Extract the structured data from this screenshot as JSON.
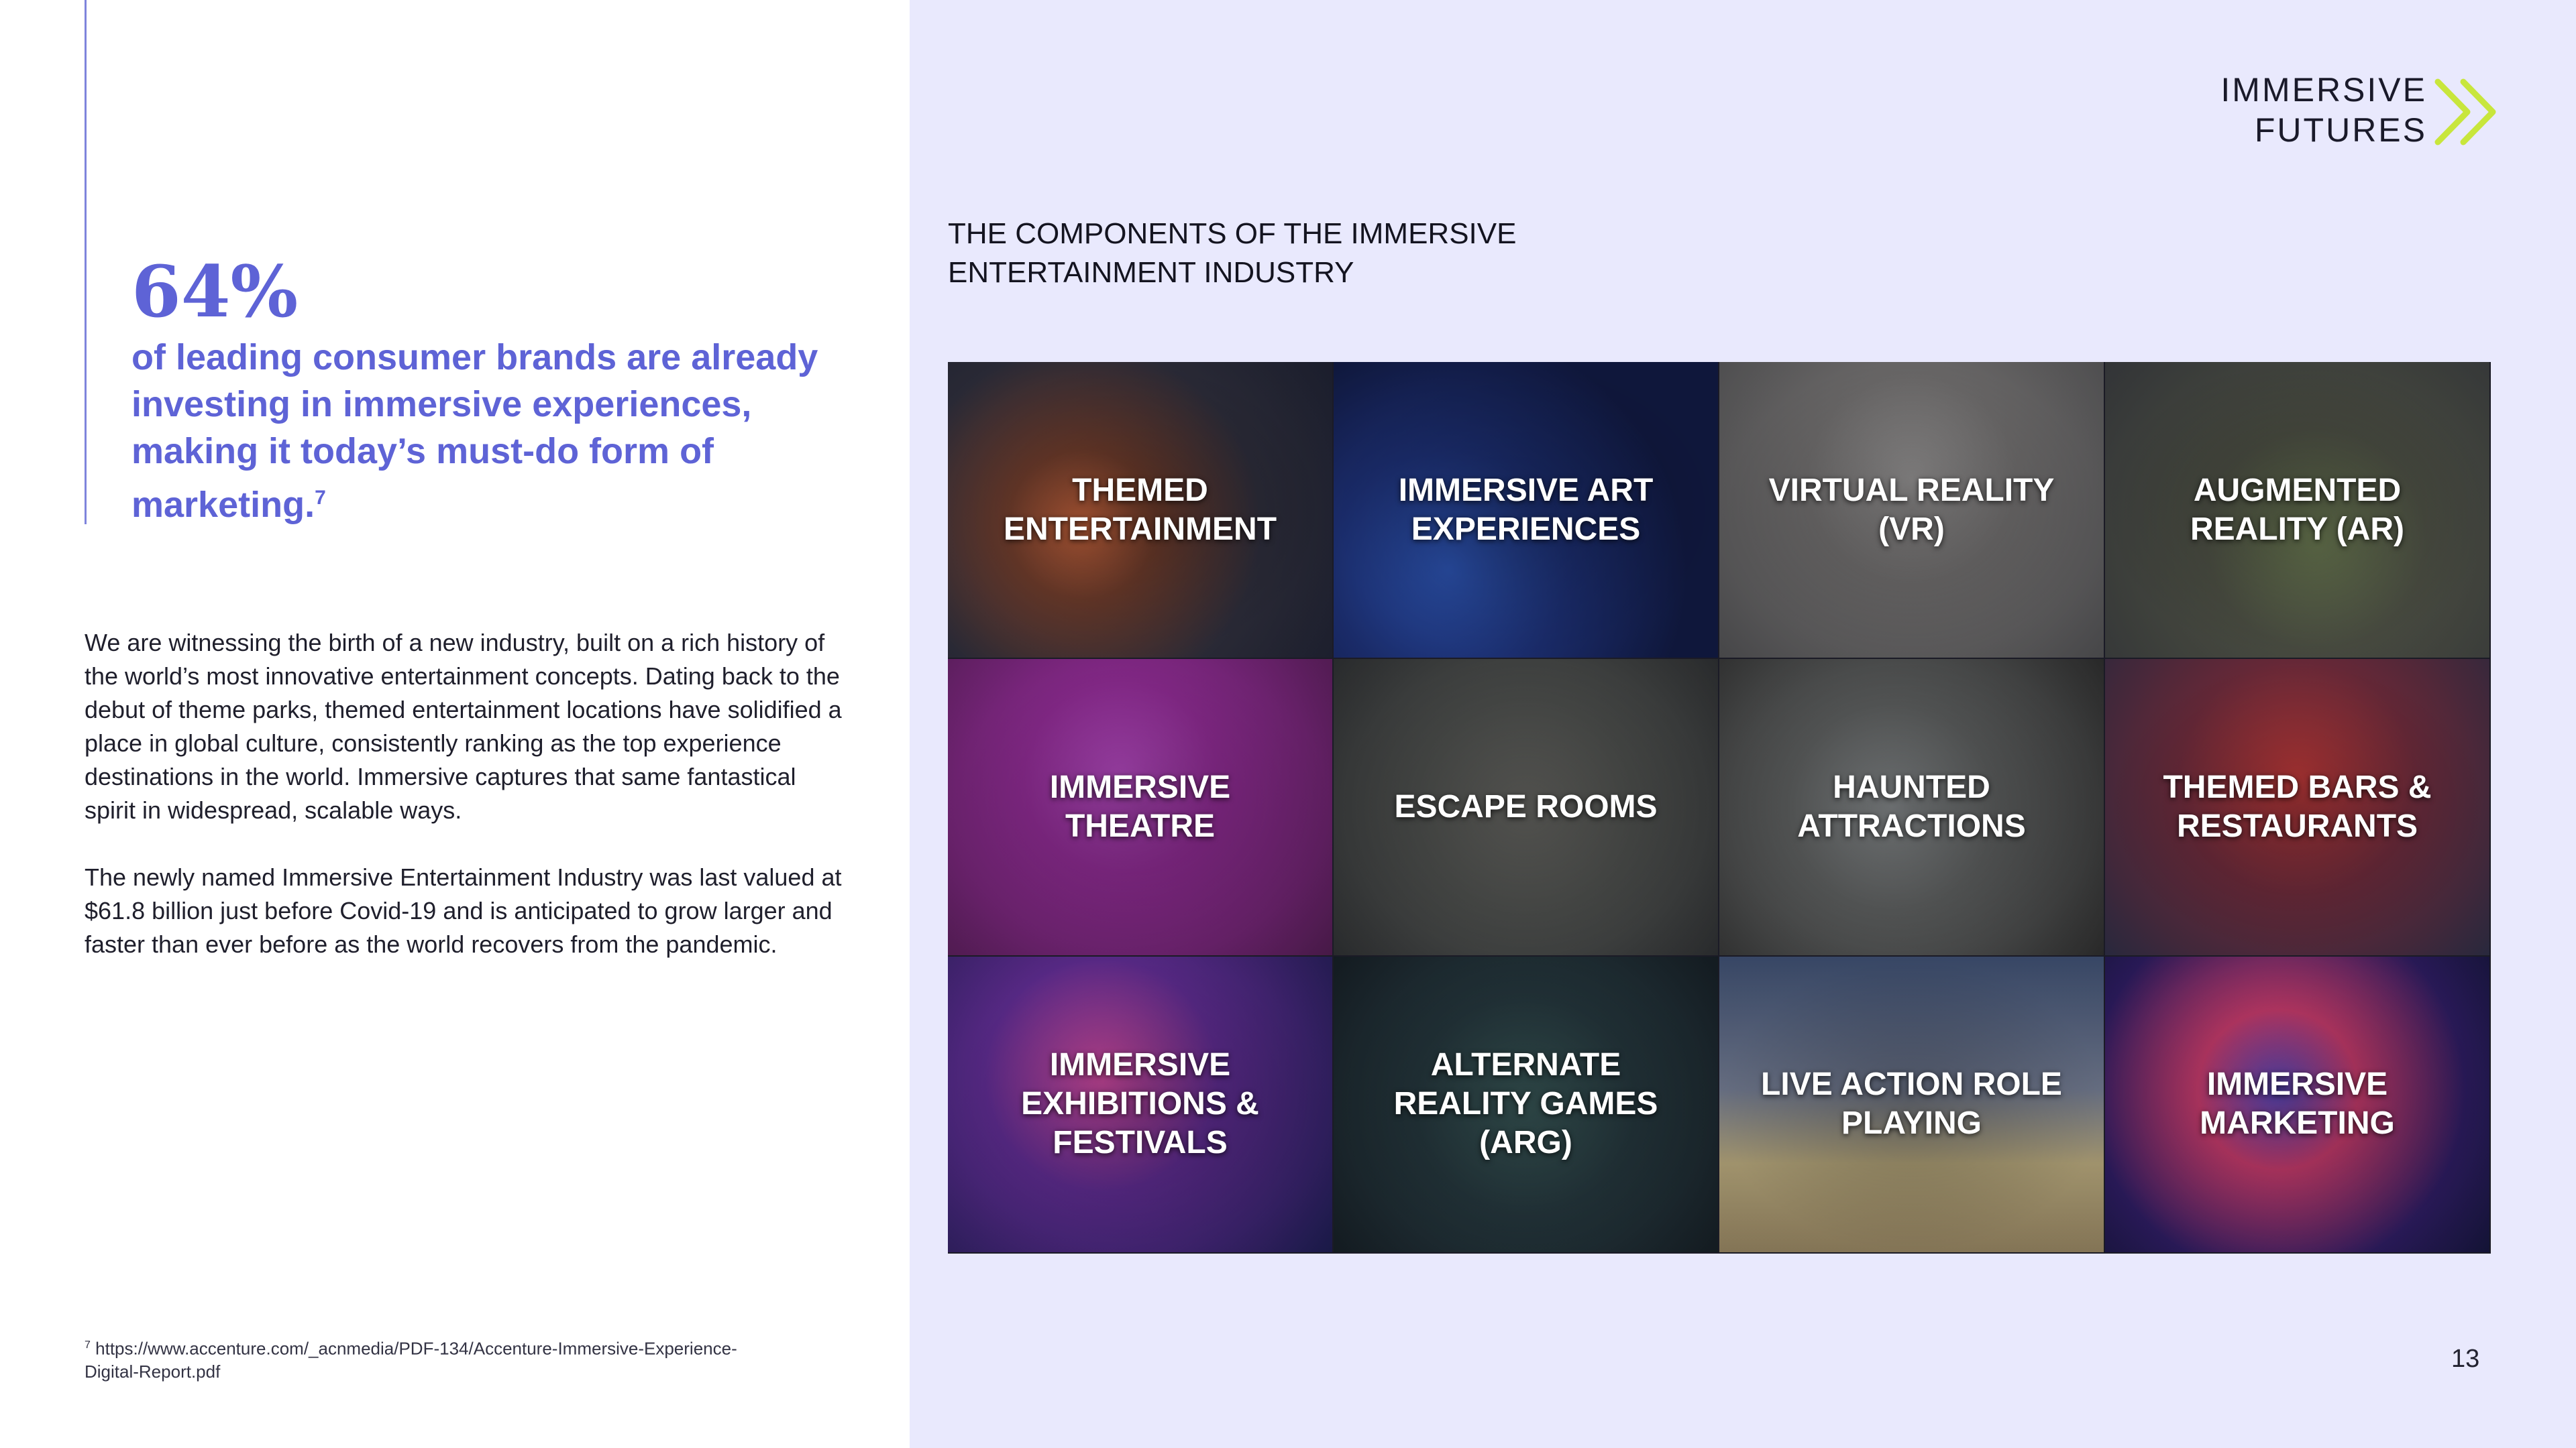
{
  "logo": {
    "line1": "IMMERSIVE",
    "line2": "FUTURES",
    "arrow_color": "#c8e63c"
  },
  "stat": {
    "value": "64%",
    "text": "of leading consumer brands are already investing in immersive experiences, making it today’s must-do form of marketing.",
    "footnote_marker": "7"
  },
  "body": {
    "paragraph1": "We are witnessing the birth of a new industry, built on a rich history of the world’s most innovative entertainment concepts. Dating back to the debut of theme parks, themed entertainment locations have solidified a place in global culture, consistently ranking as the top experience destinations in the world. Immersive captures that same fantastical spirit in widespread, scalable ways.",
    "paragraph2": "The newly named Immersive Entertainment Industry was last valued at $61.8 billion just before Covid-19 and is anticipated to grow larger and faster than ever before as the world recovers from the pandemic."
  },
  "footnote": {
    "marker": "7",
    "text": "https://www.accenture.com/_acnmedia/PDF-134/Accenture-Immersive-Experience-Digital-Report.pdf"
  },
  "section_title": "THE COMPONENTS OF THE IMMERSIVE ENTERTAINMENT INDUSTRY",
  "tiles": [
    {
      "label": "THEMED ENTERTAINMENT"
    },
    {
      "label": "IMMERSIVE ART EXPERIENCES"
    },
    {
      "label": "VIRTUAL REALITY (VR)"
    },
    {
      "label": "AUGMENTED REALITY (AR)"
    },
    {
      "label": "IMMERSIVE THEATRE"
    },
    {
      "label": "ESCAPE ROOMS"
    },
    {
      "label": "HAUNTED ATTRACTIONS"
    },
    {
      "label": "THEMED BARS & RESTAURANTS"
    },
    {
      "label": "IMMERSIVE EXHIBITIONS & FESTIVALS"
    },
    {
      "label": "ALTERNATE REALITY GAMES (ARG)"
    },
    {
      "label": "LIVE ACTION ROLE PLAYING"
    },
    {
      "label": "IMMERSIVE MARKETING"
    }
  ],
  "page_number": "13"
}
